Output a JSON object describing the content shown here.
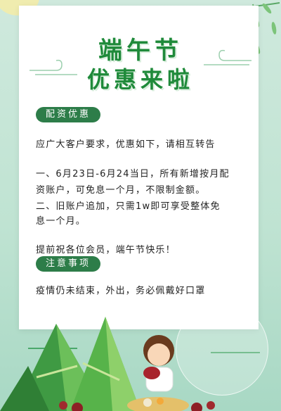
{
  "title": {
    "line1": "端午节",
    "line2": "优惠来啦"
  },
  "section1": {
    "badge": "配资优惠",
    "intro": "应广大客户要求，优惠如下，请相互转告",
    "item1_line1": "一、6月23日-6月24当日，所有新增按月配",
    "item1_line2": "资账户，可免息一个月，不限制金额。",
    "item2_line1": "二、旧账户追加，只需1w即可享受整体免",
    "item2_line2": "息一个月。",
    "greeting": "提前祝各位会员，端午节快乐！"
  },
  "section2": {
    "badge": "注意事项",
    "note": "疫情仍未结束，外出，务必佩戴好口罩"
  },
  "colors": {
    "accent": "#2d7d49",
    "title": "#1f8a3a",
    "background": "#cfe9dd"
  }
}
